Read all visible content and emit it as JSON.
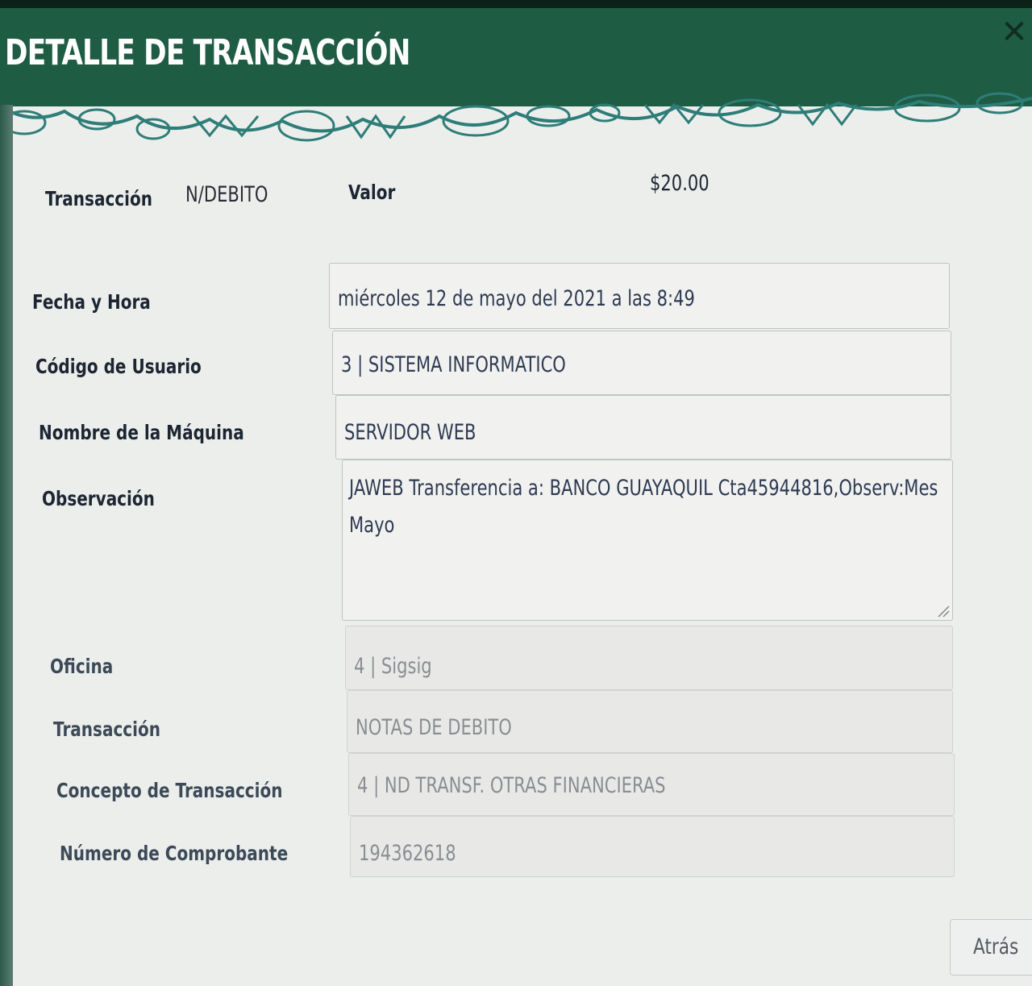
{
  "dialog": {
    "title": "DETALLE DE TRANSACCIÓN",
    "close_icon": "close-icon"
  },
  "summary": {
    "transaccion_label": "Transacción",
    "transaccion_value": "N/DEBITO",
    "valor_label": "Valor",
    "valor_value": "$20.00"
  },
  "fields": {
    "fecha": {
      "label": "Fecha y Hora",
      "value": "miércoles 12 de mayo del 2021 a las  8:49"
    },
    "usuario": {
      "label": "Código de Usuario",
      "value": "3 | SISTEMA INFORMATICO"
    },
    "maquina": {
      "label": "Nombre de la Máquina",
      "value": "SERVIDOR WEB"
    },
    "observacion": {
      "label": "Observación",
      "value": "JAWEB Transferencia a: BANCO GUAYAQUIL Cta45944816,Observ:Mes Mayo"
    },
    "oficina": {
      "label": "Oficina",
      "value": "4 | Sigsig"
    },
    "transaccion": {
      "label": "Transacción",
      "value": "NOTAS DE DEBITO"
    },
    "concepto": {
      "label": "Concepto de Transacción",
      "value": "4 | ND TRANSF. OTRAS FINANCIERAS"
    },
    "comprobante": {
      "label": "Número de Comprobante",
      "value": "194362618"
    }
  },
  "footer": {
    "back_label": "Atrás"
  },
  "colors": {
    "header_bg": "#1f5c44",
    "pattern": "#2e7d78",
    "panel_bg": "#eceeec"
  }
}
